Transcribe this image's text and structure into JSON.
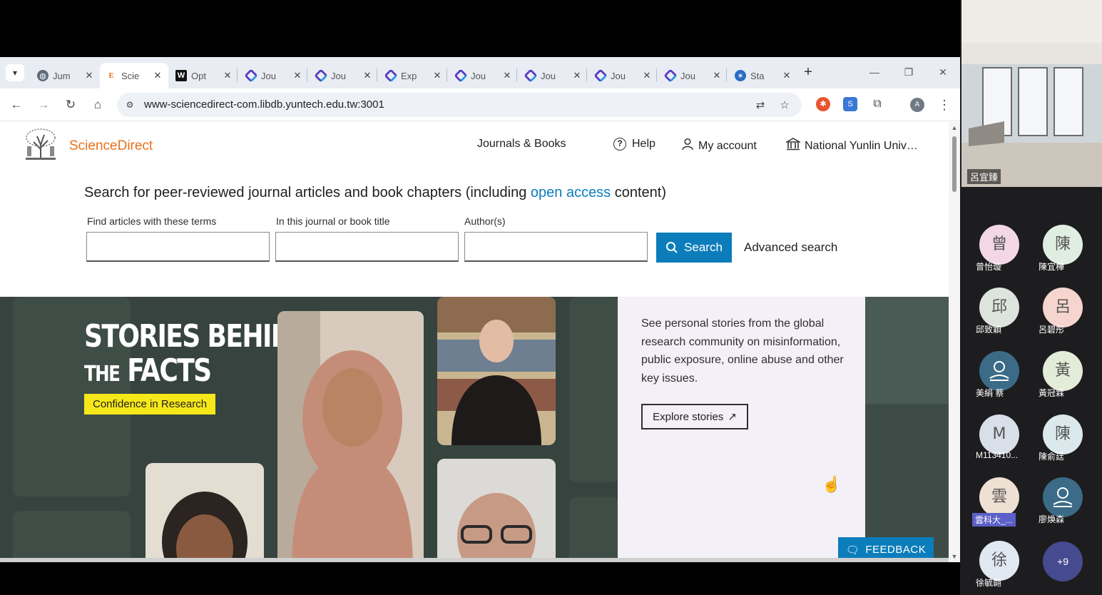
{
  "browser": {
    "tabs": [
      {
        "title": "Jum",
        "favicon": "globe-icon",
        "active": false
      },
      {
        "title": "Scie",
        "favicon": "elsevier-e-icon",
        "active": true
      },
      {
        "title": "Opt",
        "favicon": "w-icon",
        "active": false
      },
      {
        "title": "Jou",
        "favicon": "cube-icon",
        "active": false
      },
      {
        "title": "Jou",
        "favicon": "cube-icon",
        "active": false
      },
      {
        "title": "Exp",
        "favicon": "cube-icon",
        "active": false
      },
      {
        "title": "Jou",
        "favicon": "cube-icon",
        "active": false
      },
      {
        "title": "Jou",
        "favicon": "cube-icon",
        "active": false
      },
      {
        "title": "Jou",
        "favicon": "cube-icon",
        "active": false
      },
      {
        "title": "Jou",
        "favicon": "cube-icon",
        "active": false
      },
      {
        "title": "Sta",
        "favicon": "star-globe-icon",
        "active": false
      }
    ],
    "close_glyph": "✕",
    "new_tab_glyph": "+",
    "address": "www-sciencedirect-com.libdb.yuntech.edu.tw:3001",
    "profile_initial": "A"
  },
  "header": {
    "brand": "ScienceDirect",
    "nav": {
      "journals_books": "Journals & Books",
      "help": "Help",
      "my_account": "My account",
      "institution": "National Yunlin Univ…"
    }
  },
  "search": {
    "heading_prefix": "Search for peer-reviewed journal articles and book chapters (including ",
    "heading_link": "open access",
    "heading_suffix": " content)",
    "fields": [
      {
        "label": "Find articles with these terms",
        "value": ""
      },
      {
        "label": "In this journal or book title",
        "value": ""
      },
      {
        "label": "Author(s)",
        "value": ""
      }
    ],
    "button": "Search",
    "advanced": "Advanced search"
  },
  "hero": {
    "title_line1": "STORIES BEHIND",
    "title_line2_small": "THE",
    "title_line2_big": "FACTS",
    "tag": "Confidence in Research",
    "description": "See personal stories from the global research community on misinformation, public exposure, online abuse and other key issues.",
    "explore": "Explore stories",
    "feedback": "FEEDBACK"
  },
  "meeting": {
    "video_name": "呂宜臻",
    "participants": [
      {
        "initial": "曾",
        "name": "曾怡璇",
        "bg": "#f3d7e6"
      },
      {
        "initial": "陳",
        "name": "陳宜樺",
        "bg": "#dfeee1"
      },
      {
        "initial": "邱",
        "name": "邱致穎",
        "bg": "#dde3dd"
      },
      {
        "initial": "呂",
        "name": "呂碧彤",
        "bg": "#f6d5cf"
      },
      {
        "initial": "",
        "name": "美絹 蔡",
        "bg": "#3b6b87"
      },
      {
        "initial": "黃",
        "name": "黃冠霖",
        "bg": "#e3ecd9"
      },
      {
        "initial": "M",
        "name": "M113410...",
        "bg": "#d9dfe9"
      },
      {
        "initial": "陳",
        "name": "陳俞廷",
        "bg": "#dbe9ec"
      },
      {
        "initial": "雲",
        "name": "雲科大_...",
        "bg": "#efe0d4"
      },
      {
        "initial": "",
        "name": "廖煥森",
        "bg": "#3b6b87"
      },
      {
        "initial": "徐",
        "name": "徐毓翾",
        "bg": "#e0e9f2"
      }
    ],
    "more": "+9"
  }
}
